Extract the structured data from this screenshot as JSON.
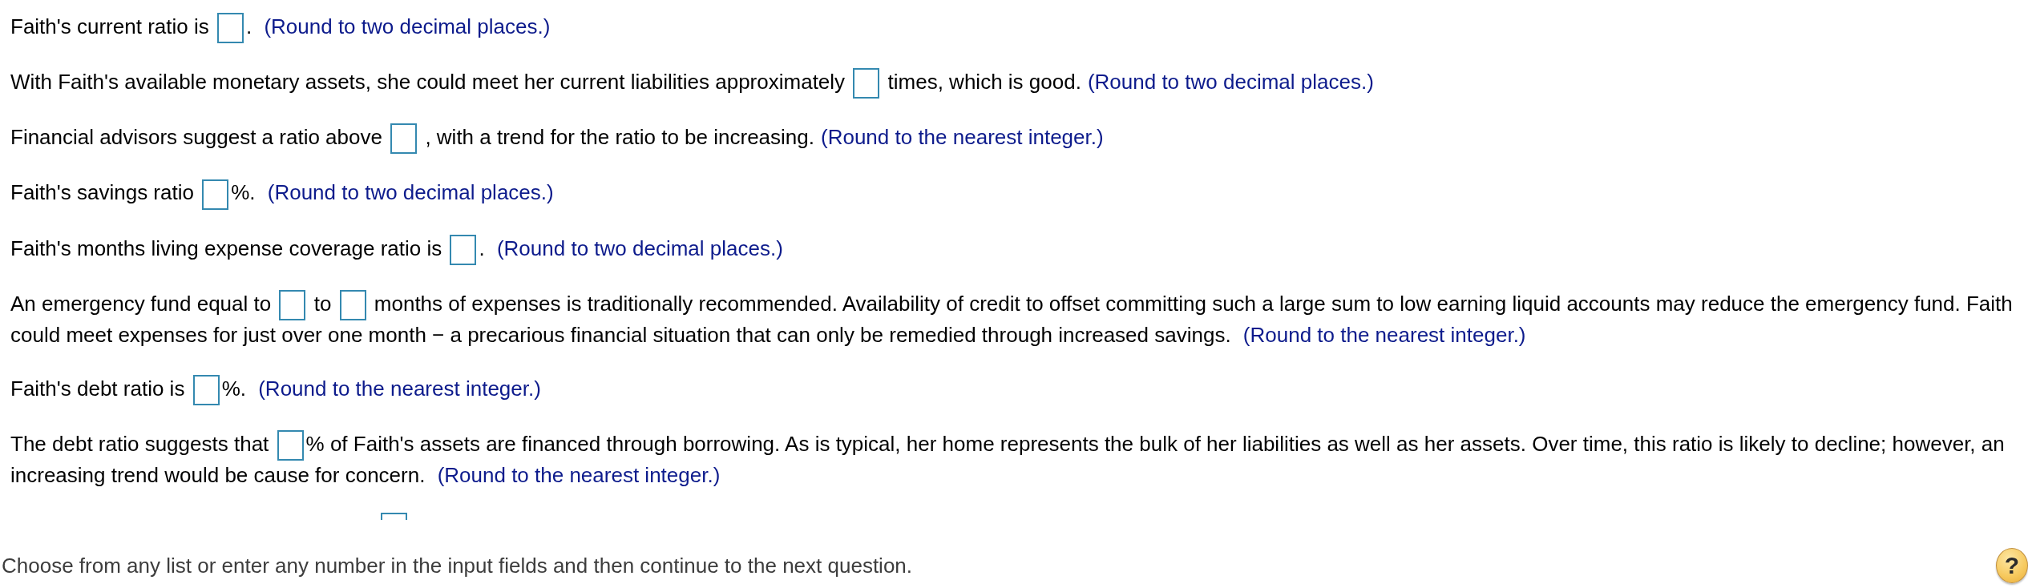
{
  "questions": [
    {
      "lines": [
        {
          "parts": [
            {
              "kind": "text",
              "text": "Faith's current ratio is "
            },
            {
              "kind": "blank"
            },
            {
              "kind": "text",
              "text": ". "
            },
            {
              "kind": "hint",
              "text": "(Round to two decimal places.)"
            }
          ]
        }
      ]
    },
    {
      "lines": [
        {
          "parts": [
            {
              "kind": "text",
              "text": "With Faith's available monetary assets, she could meet her current liabilities approximately "
            },
            {
              "kind": "blank"
            },
            {
              "kind": "text",
              "text": " times, which is good."
            },
            {
              "kind": "hint",
              "text": "(Round to two decimal places.)"
            }
          ]
        }
      ]
    },
    {
      "lines": [
        {
          "parts": [
            {
              "kind": "text",
              "text": "Financial advisors suggest a ratio above "
            },
            {
              "kind": "blank"
            },
            {
              "kind": "text",
              "text": " , with a trend for the ratio to be increasing."
            },
            {
              "kind": "hint",
              "text": "(Round to the nearest integer.)"
            }
          ]
        }
      ]
    },
    {
      "lines": [
        {
          "parts": [
            {
              "kind": "text",
              "text": "Faith's savings ratio "
            },
            {
              "kind": "blank"
            },
            {
              "kind": "text",
              "text": "%. "
            },
            {
              "kind": "hint",
              "text": "(Round to two decimal places.)"
            }
          ]
        }
      ]
    },
    {
      "lines": [
        {
          "parts": [
            {
              "kind": "text",
              "text": "Faith's months living expense coverage ratio is "
            },
            {
              "kind": "blank"
            },
            {
              "kind": "text",
              "text": ". "
            },
            {
              "kind": "hint",
              "text": "(Round to two decimal places.)"
            }
          ]
        }
      ]
    },
    {
      "lines": [
        {
          "parts": [
            {
              "kind": "text",
              "text": "An emergency fund equal to "
            },
            {
              "kind": "blank"
            },
            {
              "kind": "text",
              "text": " to "
            },
            {
              "kind": "blank"
            },
            {
              "kind": "text",
              "text": " months of expenses is traditionally recommended. Availability of credit to offset committing such a large sum to low earning liquid accounts may reduce the emergency fund. Faith"
            }
          ]
        },
        {
          "parts": [
            {
              "kind": "text",
              "text": "could meet expenses for just over one month − a precarious financial situation that can only be remedied through increased savings. "
            },
            {
              "kind": "hint",
              "text": "(Round to the nearest integer.)"
            }
          ]
        }
      ]
    },
    {
      "lines": [
        {
          "parts": [
            {
              "kind": "text",
              "text": "Faith's debt ratio is "
            },
            {
              "kind": "blank"
            },
            {
              "kind": "text",
              "text": "%. "
            },
            {
              "kind": "hint",
              "text": "(Round to the nearest integer.)"
            }
          ]
        }
      ]
    },
    {
      "lines": [
        {
          "parts": [
            {
              "kind": "text",
              "text": "The debt ratio suggests that "
            },
            {
              "kind": "blank"
            },
            {
              "kind": "text",
              "text": "% of Faith's assets are financed through borrowing. As is typical, her home represents the bulk of her liabilities as well as her assets. Over time, this ratio is likely to decline; however, an"
            }
          ]
        },
        {
          "parts": [
            {
              "kind": "text",
              "text": "increasing trend would be cause for concern. "
            },
            {
              "kind": "hint",
              "text": "(Round to the nearest integer.)"
            }
          ]
        }
      ]
    }
  ],
  "partly_hidden_question": {
    "parts": [
      {
        "kind": "blank"
      }
    ]
  },
  "footer": {
    "instruction": "Choose from any list or enter any number in the input fields and then continue to the next question.",
    "help_button": {
      "label": "?"
    }
  }
}
